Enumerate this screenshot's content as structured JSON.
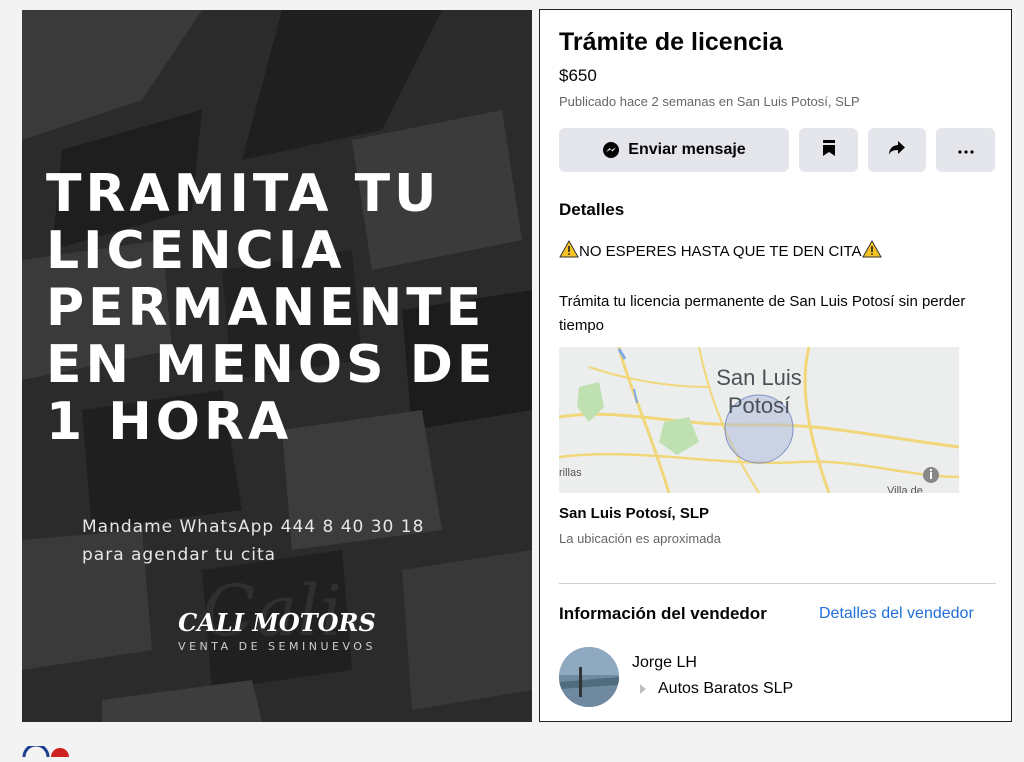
{
  "promo": {
    "headline_lines": [
      "TRAMITA TU",
      "LICENCIA",
      "PERMANENTE",
      "EN MENOS DE",
      "1 HORA"
    ],
    "whatsapp_line1": "Mandame WhatsApp 444 8 40 30 18",
    "whatsapp_line2": "para agendar tu cita",
    "brand": "CALI MOTORS",
    "brand_subtitle": "VENTA DE SEMINUEVOS"
  },
  "listing": {
    "title": "Trámite de licencia",
    "price": "$650",
    "published": "Publicado hace 2 semanas en San Luis Potosí, SLP",
    "message_button": "Enviar mensaje",
    "icons": {
      "messenger": "messenger-icon",
      "save": "bookmark-icon",
      "share": "share-icon",
      "more": "more-icon",
      "warning": "warning-icon",
      "info": "info-icon"
    },
    "details_title": "Detalles",
    "description_alert": "NO ESPERES HASTA QUE TE DEN CITA",
    "description_body": "Trámita tu licencia permanente de San Luis Potosí sin perder tiempo",
    "map": {
      "city_line1": "San Luis",
      "city_line2": "Potosí",
      "left_label": "rillas",
      "right_label": "Villa de"
    },
    "location": "San Luis Potosí, SLP",
    "location_note": "La ubicación es aproximada",
    "seller_title": "Información del vendedor",
    "seller_link": "Detalles del vendedor",
    "seller_name": "Jorge LH",
    "seller_group": "Autos Baratos SLP"
  },
  "colors": {
    "link": "#216fdb",
    "button_bg": "#e4e6eb",
    "promo_bg": "#2a2a2a",
    "warning": "#f7c325"
  }
}
